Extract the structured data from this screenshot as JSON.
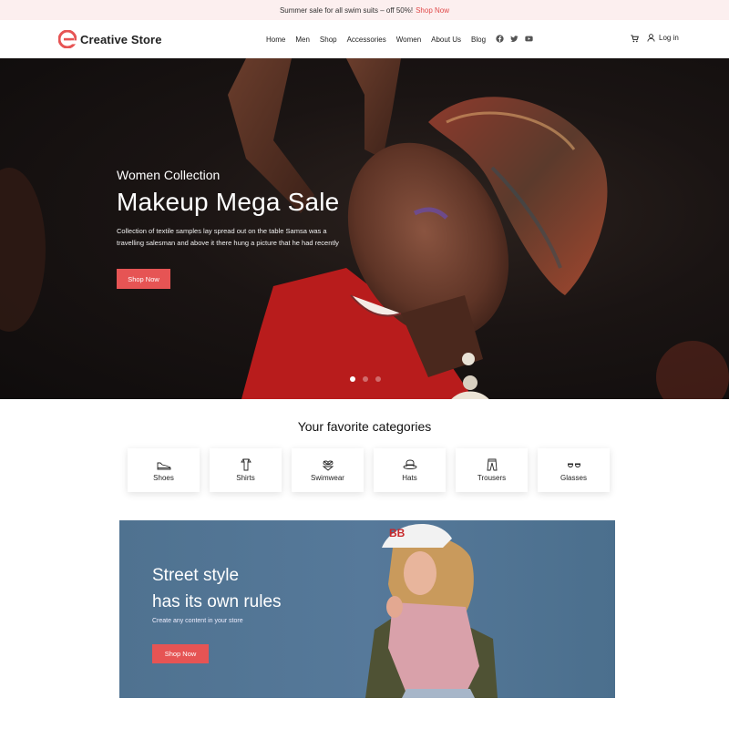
{
  "announcement": {
    "text": "Summer sale for all swim suits – off 50%!",
    "link": "Shop Now"
  },
  "header": {
    "brand": "Creative Store",
    "nav": [
      "Home",
      "Men",
      "Shop",
      "Accessories",
      "Women",
      "About Us",
      "Blog"
    ],
    "social_icons": [
      "facebook-icon",
      "twitter-icon",
      "youtube-icon"
    ],
    "cart_icon": "cart-icon",
    "login": "Log in"
  },
  "hero": {
    "subtitle": "Women Collection",
    "title": "Makeup Mega Sale",
    "description": "Collection of textile samples lay spread out on the table Samsa was a travelling salesman and above it there hung a picture that he had recently",
    "button": "Shop Now",
    "slides_count": 3,
    "active_slide": 1
  },
  "categories": {
    "title": "Your favorite categories",
    "items": [
      {
        "label": "Shoes",
        "icon": "shoe-icon"
      },
      {
        "label": "Shirts",
        "icon": "shirt-icon"
      },
      {
        "label": "Swimwear",
        "icon": "swimwear-icon"
      },
      {
        "label": "Hats",
        "icon": "hat-icon"
      },
      {
        "label": "Trousers",
        "icon": "trousers-icon"
      },
      {
        "label": "Glasses",
        "icon": "glasses-icon"
      }
    ]
  },
  "promo": {
    "title_line1": "Street style",
    "title_line2": "has its own rules",
    "subtitle": "Create any content in your store",
    "button": "Shop Now"
  },
  "colors": {
    "accent": "#e65454",
    "announcement_bg": "#fcefef",
    "promo_bg": "#52759a"
  }
}
